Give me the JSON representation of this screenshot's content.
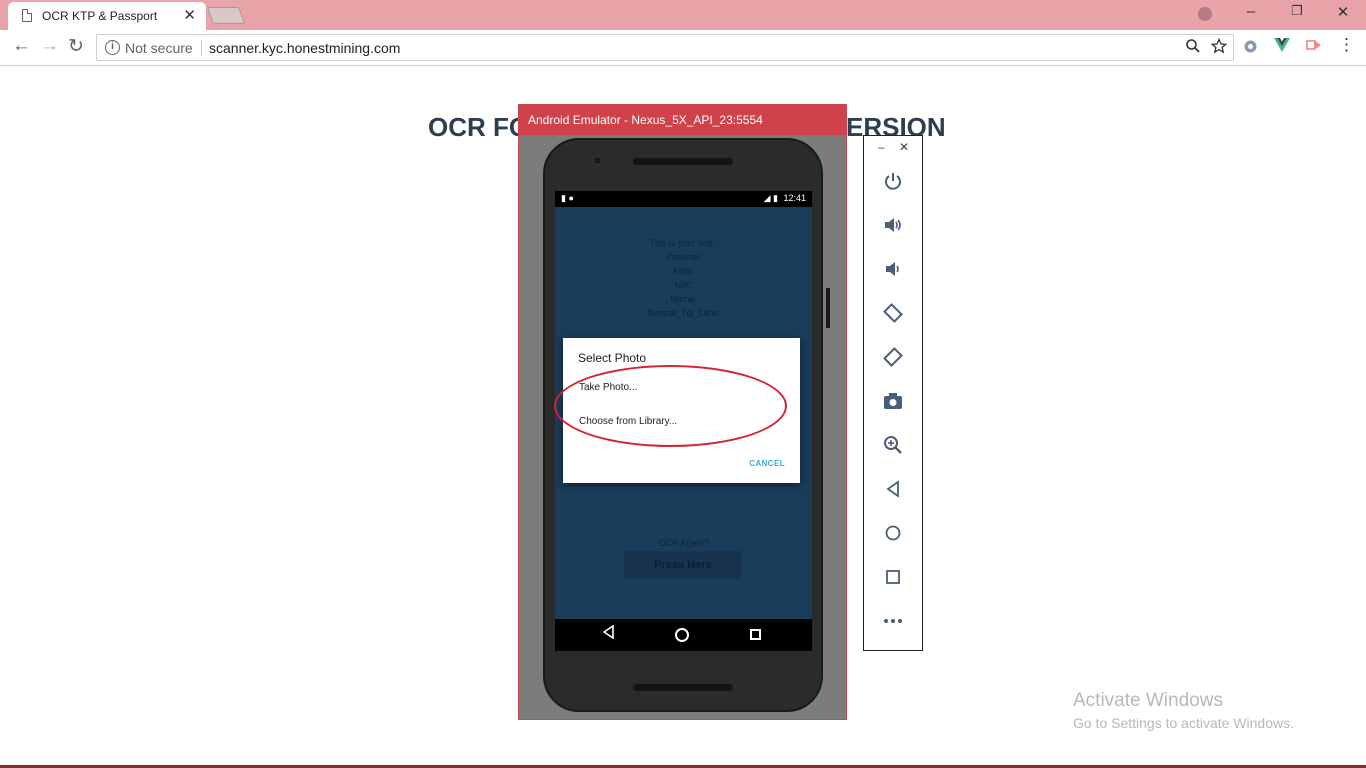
{
  "browser": {
    "tab_title": "OCR KTP & Passport",
    "tab_close": "✕",
    "not_secure": "Not secure",
    "url": "scanner.kyc.honestmining.com",
    "window_minimize": "–",
    "window_restore": "❐",
    "window_close": "✕",
    "nav_back": "←",
    "nav_forward": "→",
    "nav_reload": "↻",
    "menu": "⋮"
  },
  "page": {
    "heading_left": "OCR FO",
    "heading_right": "ERSION"
  },
  "emulator": {
    "window_title": "Android Emulator - Nexus_5X_API_23:5554",
    "status_time": "12:41",
    "app_lines": [
      "This is your text :",
      "Provinsi:",
      "Kota:",
      "NIK:",
      "Nama:",
      "Tempat_Tgl_Lahir:"
    ],
    "ocr_again": "OCR Again?",
    "press_here": "Press Here",
    "dialog": {
      "title": "Select Photo",
      "item_take": "Take Photo...",
      "item_library": "Choose from Library...",
      "cancel": "CANCEL"
    },
    "panel": {
      "minimize": "–",
      "close": "✕",
      "icons": [
        "power-icon",
        "volume-up-icon",
        "volume-down-icon",
        "rotate-left-icon",
        "rotate-right-icon",
        "camera-icon",
        "zoom-icon",
        "back-icon",
        "home-icon",
        "overview-icon",
        "more-icon"
      ]
    }
  },
  "watermark": {
    "line1": "Activate Windows",
    "line2": "Go to Settings to activate Windows."
  }
}
